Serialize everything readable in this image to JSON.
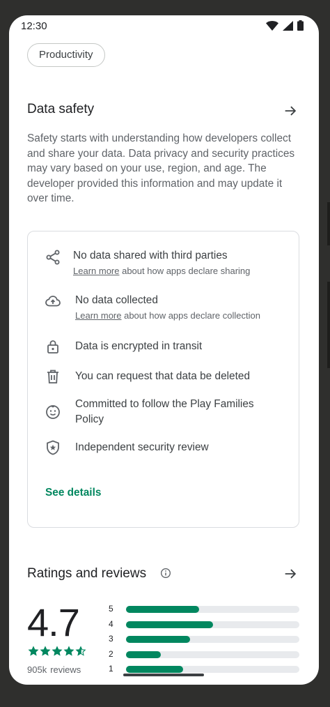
{
  "status_bar": {
    "time": "12:30"
  },
  "category_chip": "Productivity",
  "data_safety": {
    "title": "Data safety",
    "description": "Safety starts with understanding how developers collect and share your data. Data privacy and security practices may vary based on your use, region, and age. The developer provided this information and may update it over time.",
    "items": [
      {
        "icon": "share-icon",
        "text": "No data shared with third parties",
        "link": "Learn more",
        "sub": " about how apps declare sharing"
      },
      {
        "icon": "cloud-upload-icon",
        "text": "No data collected",
        "link": "Learn more",
        "sub": " about how apps declare collection"
      },
      {
        "icon": "lock-icon",
        "text": "Data is encrypted in transit"
      },
      {
        "icon": "trash-icon",
        "text": "You can request that data be deleted"
      },
      {
        "icon": "families-icon",
        "text": "Committed to follow the Play Families Policy"
      },
      {
        "icon": "shield-star-icon",
        "text": "Independent security review"
      }
    ],
    "see_details": "See details"
  },
  "ratings": {
    "title": "Ratings and reviews",
    "score": "4.7",
    "stars": 4.7,
    "review_count": "905k",
    "review_label": "reviews",
    "distribution": [
      {
        "label": "5",
        "fraction": 0.42
      },
      {
        "label": "4",
        "fraction": 0.5
      },
      {
        "label": "3",
        "fraction": 0.37
      },
      {
        "label": "2",
        "fraction": 0.2
      },
      {
        "label": "1",
        "fraction": 0.33
      }
    ]
  },
  "colors": {
    "accent": "#01875f",
    "text_primary": "#202124",
    "text_secondary": "#5f6368",
    "frame": "#2f2f2d"
  }
}
